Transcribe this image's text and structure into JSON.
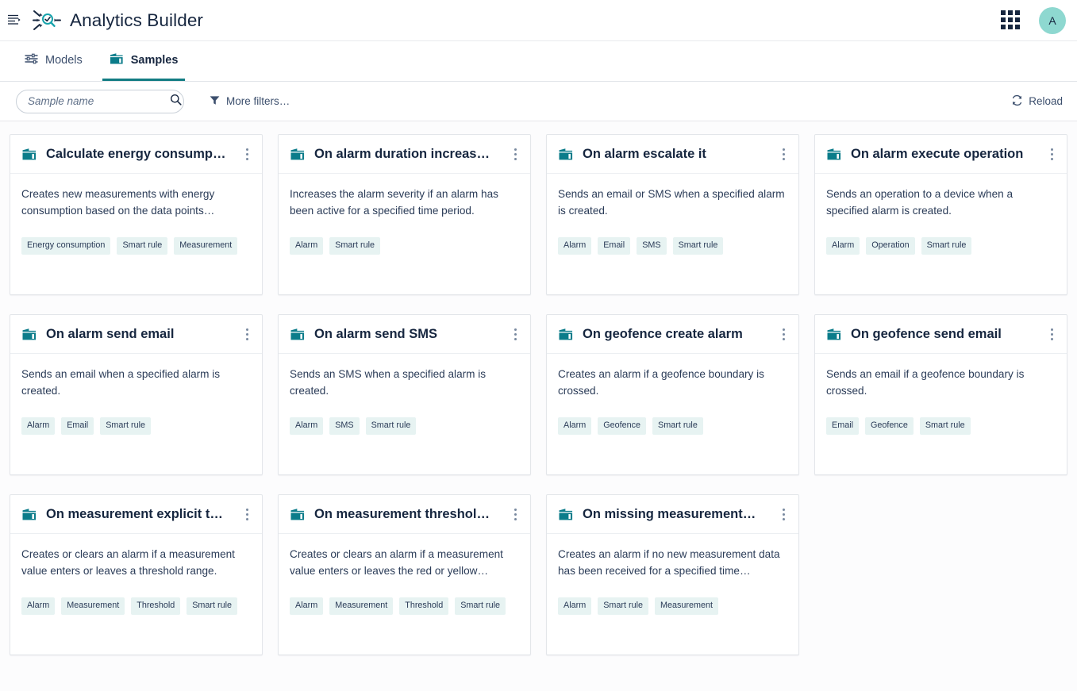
{
  "header": {
    "title": "Analytics Builder",
    "menu_icon": "hamburger-menu-icon",
    "logo_icon": "analytics-builder-logo-icon",
    "app_switcher_icon": "app-grid-icon",
    "avatar_initial": "A"
  },
  "tabs": [
    {
      "label": "Models",
      "icon": "models-icon",
      "active": false
    },
    {
      "label": "Samples",
      "icon": "folder-icon",
      "active": true
    }
  ],
  "filterbar": {
    "search_placeholder": "Sample name",
    "search_value": "",
    "search_icon": "search-icon",
    "more_filters_label": "More filters…",
    "filter_icon": "funnel-icon",
    "reload_label": "Reload",
    "reload_icon": "refresh-icon"
  },
  "colors": {
    "accent_teal": "#127c83",
    "icon_teal": "#0b7c8a",
    "avatar_bg": "#8ed8d0",
    "text_navy": "#16263f",
    "tag_bg": "#e7f3f2"
  },
  "cards": [
    {
      "title": "Calculate energy consump…",
      "description": "Creates new measurements with energy consumption based on the data points…",
      "tags": [
        "Energy consumption",
        "Smart rule",
        "Measurement"
      ]
    },
    {
      "title": "On alarm duration increas…",
      "description": "Increases the alarm severity if an alarm has been active for a specified time period.",
      "tags": [
        "Alarm",
        "Smart rule"
      ]
    },
    {
      "title": "On alarm escalate it",
      "description": "Sends an email or SMS when a specified alarm is created.",
      "tags": [
        "Alarm",
        "Email",
        "SMS",
        "Smart rule"
      ]
    },
    {
      "title": "On alarm execute operation",
      "description": "Sends an operation to a device when a specified alarm is created.",
      "tags": [
        "Alarm",
        "Operation",
        "Smart rule"
      ]
    },
    {
      "title": "On alarm send email",
      "description": "Sends an email when a specified alarm is created.",
      "tags": [
        "Alarm",
        "Email",
        "Smart rule"
      ]
    },
    {
      "title": "On alarm send SMS",
      "description": "Sends an SMS when a specified alarm is created.",
      "tags": [
        "Alarm",
        "SMS",
        "Smart rule"
      ]
    },
    {
      "title": "On geofence create alarm",
      "description": "Creates an alarm if a geofence boundary is crossed.",
      "tags": [
        "Alarm",
        "Geofence",
        "Smart rule"
      ]
    },
    {
      "title": "On geofence send email",
      "description": "Sends an email if a geofence boundary is crossed.",
      "tags": [
        "Email",
        "Geofence",
        "Smart rule"
      ]
    },
    {
      "title": "On measurement explicit t…",
      "description": "Creates or clears an alarm if a measurement value enters or leaves a threshold range.",
      "tags": [
        "Alarm",
        "Measurement",
        "Threshold",
        "Smart rule"
      ]
    },
    {
      "title": "On measurement threshol…",
      "description": "Creates or clears an alarm if a measurement value enters or leaves the red or yellow…",
      "tags": [
        "Alarm",
        "Measurement",
        "Threshold",
        "Smart rule"
      ]
    },
    {
      "title": "On missing measurement…",
      "description": "Creates an alarm if no new measurement data has been received for a specified time…",
      "tags": [
        "Alarm",
        "Smart rule",
        "Measurement"
      ]
    }
  ]
}
